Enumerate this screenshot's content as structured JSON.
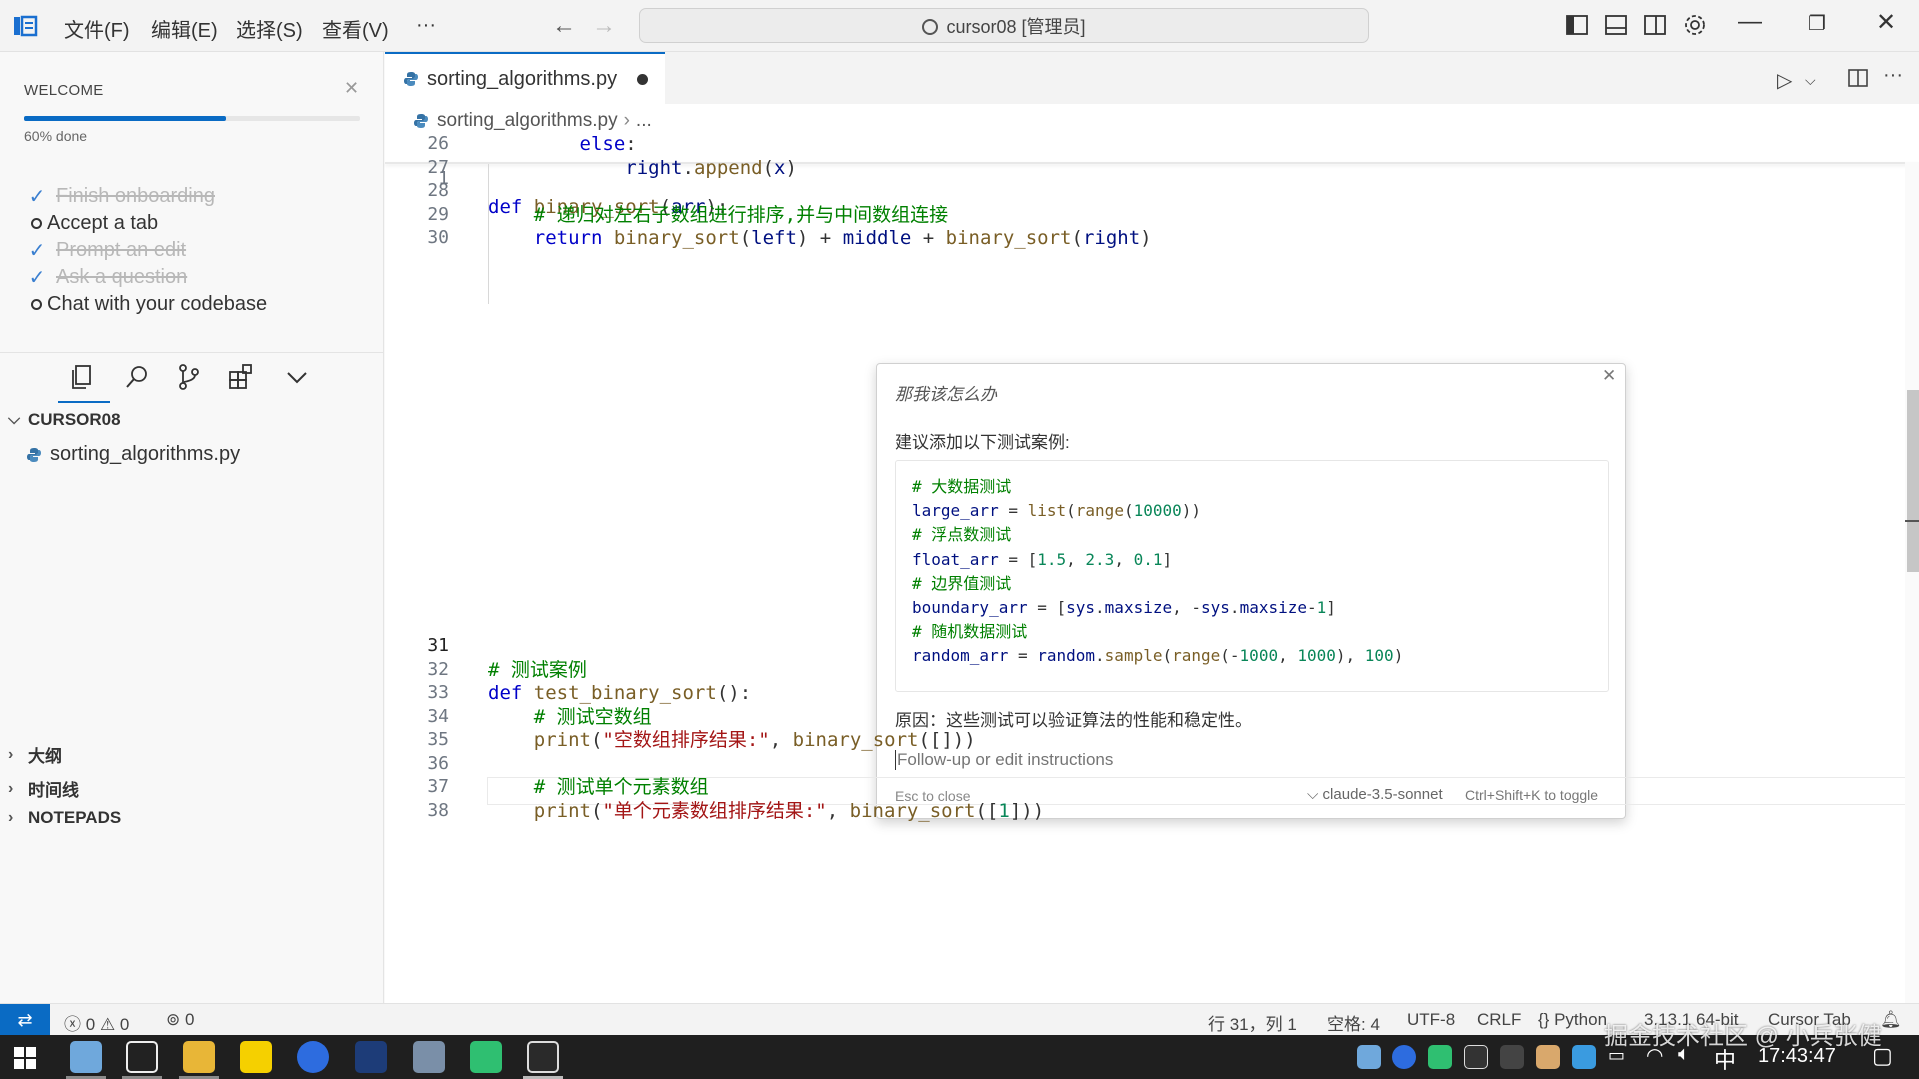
{
  "menu": [
    "文件(F)",
    "编辑(E)",
    "选择(S)",
    "查看(V)",
    "···"
  ],
  "command_center": "cursor08 [管理员]",
  "welcome": {
    "title": "WELCOME",
    "progress_text": "60% done",
    "progress": 0.6,
    "tasks": [
      {
        "label": "Finish onboarding",
        "done": true
      },
      {
        "label": "Accept a tab",
        "done": false
      },
      {
        "label": "Prompt an edit",
        "done": true
      },
      {
        "label": "Ask a question",
        "done": true
      },
      {
        "label": "Chat with your codebase",
        "done": false
      }
    ]
  },
  "explorer": {
    "folder": "CURSOR08",
    "file": "sorting_algorithms.py"
  },
  "sections": [
    "大纲",
    "时间线",
    "NOTEPADS"
  ],
  "tab": {
    "label": "sorting_algorithms.py"
  },
  "breadcrumb": {
    "file": "sorting_algorithms.py",
    "rest": "..."
  },
  "sticky_line": {
    "num": "1",
    "text": "def binary_sort(arr):"
  },
  "code_top": [
    {
      "num": "26",
      "text": "        else:"
    },
    {
      "num": "27",
      "text": "            right.append(x)"
    },
    {
      "num": "28",
      "text": ""
    },
    {
      "num": "29",
      "text": "    # 递归对左右子数组进行排序,并与中间数组连接"
    },
    {
      "num": "30",
      "text": "    return binary_sort(left) + middle + binary_sort(right)"
    }
  ],
  "code_bottom": [
    {
      "num": "31",
      "text": ""
    },
    {
      "num": "32",
      "text": "# 测试案例"
    },
    {
      "num": "33",
      "text": "def test_binary_sort():"
    },
    {
      "num": "34",
      "text": "    # 测试空数组"
    },
    {
      "num": "35",
      "text": "    print(\"空数组排序结果:\", binary_sort([]))"
    },
    {
      "num": "36",
      "text": ""
    },
    {
      "num": "37",
      "text": "    # 测试单个元素数组"
    },
    {
      "num": "38",
      "text": "    print(\"单个元素数组排序结果:\", binary_sort([1]))"
    }
  ],
  "chat": {
    "query": "那我该怎么办",
    "intro": "建议添加以下测试案例:",
    "code": [
      "# 大数据测试",
      "large_arr = list(range(10000))",
      "# 浮点数测试",
      "float_arr = [1.5, 2.3, 0.1]",
      "# 边界值测试",
      "boundary_arr = [sys.maxsize, -sys.maxsize-1]",
      "# 随机数据测试",
      "random_arr = random.sample(range(-1000, 1000), 100)"
    ],
    "reason": "原因：这些测试可以验证算法的性能和稳定性。",
    "input_placeholder": "Follow-up or edit instructions",
    "esc_hint": "Esc to close",
    "model": "claude-3.5-sonnet",
    "toggle_hint": "Ctrl+Shift+K to toggle"
  },
  "status": {
    "errors": "0",
    "warnings": "0",
    "ports": "0",
    "position": "行 31，列 1",
    "spaces": "空格: 4",
    "encoding": "UTF-8",
    "eol": "CRLF",
    "language": "Python",
    "interpreter": "3.13.1 64-bit",
    "cursor_tab": "Cursor Tab"
  },
  "taskbar": {
    "ime": "中",
    "time": "17:43:47"
  },
  "watermark": "掘金技术社区 @ 小兵张健",
  "colors": {
    "accent": "#0a6bc4",
    "keyword": "#0000c8",
    "function": "#795e26",
    "comment": "#008000",
    "string": "#a31515"
  }
}
